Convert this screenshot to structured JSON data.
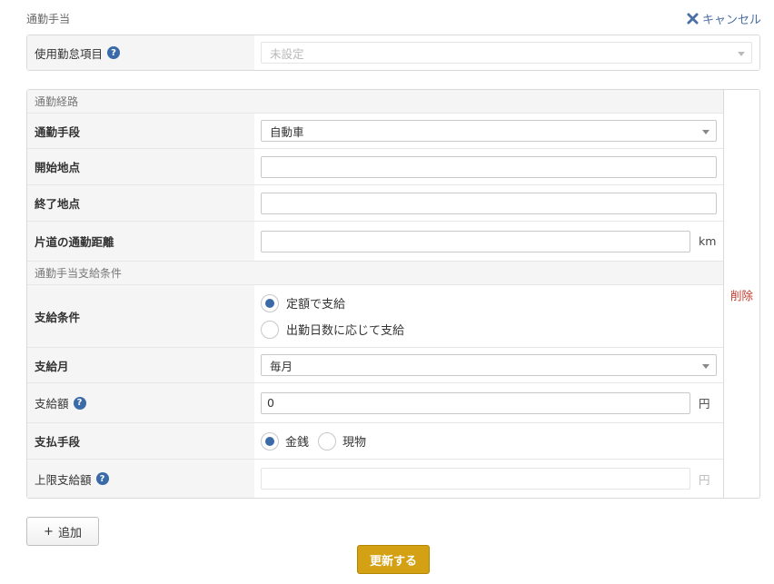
{
  "header": {
    "section_title": "通勤手当",
    "cancel_label": "キャンセル"
  },
  "usage_item": {
    "label": "使用勤怠項目",
    "value": "未設定"
  },
  "route": {
    "subheader": "通勤経路",
    "transport_label": "通勤手段",
    "transport_value": "自動車",
    "start_label": "開始地点",
    "start_value": "",
    "end_label": "終了地点",
    "end_value": "",
    "distance_label": "片道の通勤距離",
    "distance_value": "",
    "distance_unit": "km"
  },
  "conditions": {
    "subheader": "通勤手当支給条件",
    "payment_condition_label": "支給条件",
    "payment_condition_options": [
      "定額で支給",
      "出勤日数に応じて支給"
    ],
    "payment_condition_selected": 0,
    "payment_month_label": "支給月",
    "payment_month_value": "毎月",
    "amount_label": "支給額",
    "amount_value": "0",
    "amount_unit": "円",
    "payment_method_label": "支払手段",
    "payment_method_options": [
      "金銭",
      "現物"
    ],
    "payment_method_selected": 0,
    "limit_label": "上限支給額",
    "limit_value": "",
    "limit_unit": "円"
  },
  "delete_label": "削除",
  "add_label": "追加",
  "update_label": "更新する",
  "icons": {
    "cancel": "close-icon",
    "help": "help-icon",
    "add": "plus-icon"
  },
  "colors": {
    "accent": "#3a6aa8",
    "delete": "#c0392b",
    "primary_button": "#d4a014"
  }
}
